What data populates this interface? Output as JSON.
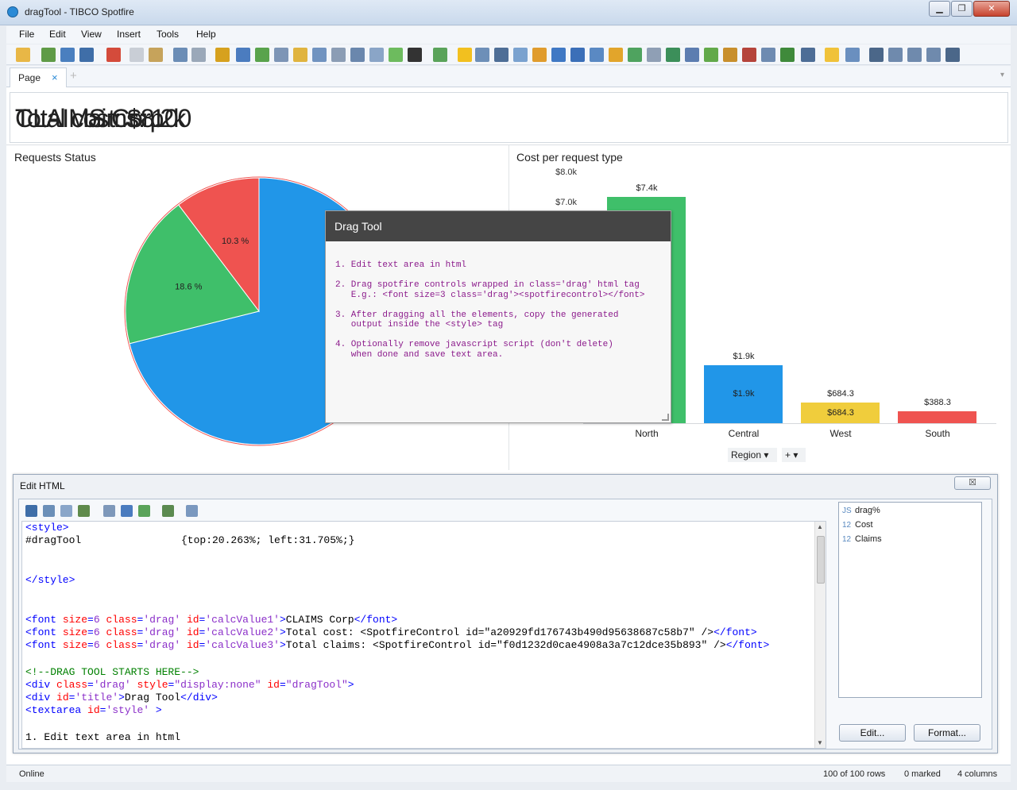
{
  "window": {
    "title": "dragTool - TIBCO Spotfire",
    "min": "▁",
    "max": "❐",
    "close": "✕"
  },
  "menu": [
    "File",
    "Edit",
    "View",
    "Insert",
    "Tools",
    "Help"
  ],
  "tabs": {
    "page_label": "Page",
    "close": "×",
    "add": "+",
    "chevron": "▾"
  },
  "overlapping_text": {
    "line1": "CLAIMS Corp",
    "line2": "Total cost: $8.2k",
    "line3": "Total claims: 100"
  },
  "pie": {
    "title": "Requests Status",
    "slices": [
      {
        "label": "",
        "value": 71.1,
        "color": "#2196e8"
      },
      {
        "label": "18.6 %",
        "value": 18.6,
        "color": "#3fbf6a"
      },
      {
        "label": "10.3 %",
        "value": 10.3,
        "color": "#ef5350"
      }
    ]
  },
  "chart_data": {
    "type": "bar",
    "title": "Cost per request type",
    "categories": [
      "North",
      "Central",
      "West",
      "South"
    ],
    "values": [
      7400,
      1900,
      684.3,
      388.3
    ],
    "value_labels": [
      "$7.4k",
      "$1.9k",
      "$684.3",
      "$388.3"
    ],
    "colors": [
      "#3fbf6a",
      "#2196e8",
      "#f0cd3c",
      "#ef5350"
    ],
    "y_ticks": [
      "$8.0k",
      "$7.0k"
    ],
    "xlabel": "Region",
    "ylim": [
      0,
      8500
    ],
    "grid": false
  },
  "axis_controls": {
    "region": "Region ▾",
    "add": "+ ▾"
  },
  "drag_tool": {
    "title": "Drag Tool",
    "instructions": "1. Edit text area in html\n\n2. Drag spotfire controls wrapped in class='drag' html tag\n   E.g.: <font size=3 class='drag'><spotfirecontrol></font>\n\n3. After dragging all the elements, copy the generated\n   output inside the <style> tag\n\n4. Optionally remove javascript script (don't delete)\n   when done and save text area."
  },
  "edit_html": {
    "title": "Edit HTML",
    "close": "☒",
    "code": {
      "l1": "<style>",
      "l2_sel": "#dragTool",
      "l2_rule": "{top:20.263%; left:31.705%;}",
      "l3": "</style>",
      "font_open": "<font",
      "size_attr": "size",
      "eq": "=",
      "size_val": "6",
      "class_attr": "class",
      "class_val": "'drag'",
      "id_attr": "id",
      "id1": "'calcValue1'",
      "id2": "'calcValue2'",
      "id3": "'calcValue3'",
      "gt": ">",
      "font_close": "</font>",
      "txt1": "CLAIMS Corp",
      "txt2": "Total cost: <SpotfireControl id=\"a20929fd176743b490d95638687c58b7\" />",
      "txt3": "Total claims: <SpotfireControl id=\"f0d1232d0cae4908a3a7c12dce35b893\" />",
      "comment": "<!--DRAG TOOL STARTS HERE-->",
      "div_open": "<div",
      "style_attr": "style",
      "style_val": "\"display:none\"",
      "drag_id_val": "\"dragTool\"",
      "title_id_val": "'title'",
      "div_txt": "Drag Tool",
      "div_close": "</div>",
      "textarea_open": "<textarea",
      "style_id_val": "'style'",
      "gt_sp": " >",
      "last": "1. Edit text area in html"
    },
    "properties": [
      {
        "icon": "JS",
        "label": "drag%"
      },
      {
        "icon": "12",
        "label": "Cost"
      },
      {
        "icon": "12",
        "label": "Claims"
      }
    ],
    "edit_button": "Edit...",
    "format_button": "Format..."
  },
  "status": {
    "online": "Online",
    "rows": "100 of 100 rows",
    "marked": "0 marked",
    "columns": "4 columns"
  }
}
